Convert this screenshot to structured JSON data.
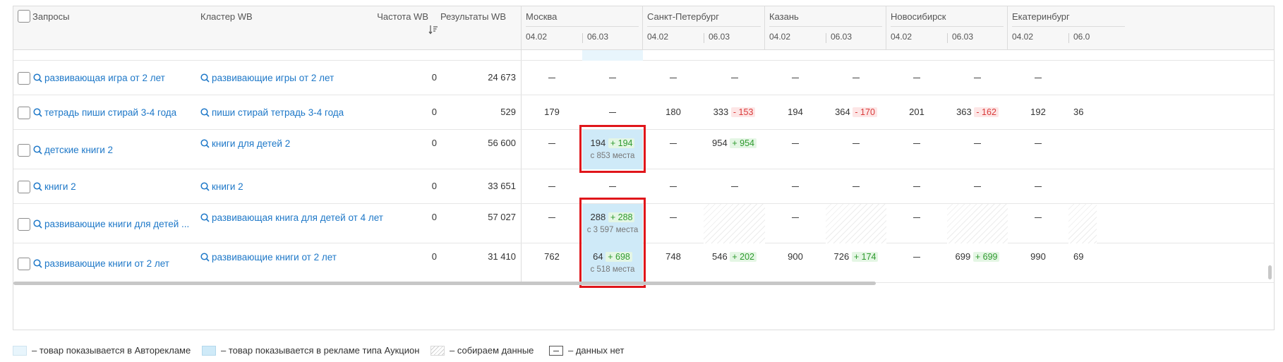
{
  "header": {
    "queries_label": "Запросы",
    "cluster_label": "Кластер WB",
    "freq_label": "Частота WB",
    "results_label": "Результаты WB",
    "cities": [
      {
        "name": "Москва",
        "d1": "04.02",
        "d2": "06.03"
      },
      {
        "name": "Санкт-Петербург",
        "d1": "04.02",
        "d2": "06.03"
      },
      {
        "name": "Казань",
        "d1": "04.02",
        "d2": "06.03"
      },
      {
        "name": "Новосибирск",
        "d1": "04.02",
        "d2": "06.03"
      },
      {
        "name": "Екатеринбург",
        "d1": "04.02",
        "d2": "06.0"
      }
    ]
  },
  "rows": [
    {
      "query": "развивающая игра от 2 лет",
      "cluster": "развивающие игры от 2 лет",
      "freq": "0",
      "results": "24 673",
      "msk1": "—",
      "msk2": "—",
      "spb1": "—",
      "spb2": "—",
      "kzn1": "—",
      "kzn2": "—",
      "nsk1": "—",
      "nsk2": "—",
      "ekb1": "—"
    },
    {
      "query": "тетрадь пиши стирай 3-4 года",
      "cluster": "пиши стирай тетрадь 3-4 года",
      "freq": "0",
      "results": "529",
      "msk1": "179",
      "msk2": "—",
      "spb1": "180",
      "spb2": "333",
      "spb2_delta": "- 153",
      "kzn1": "194",
      "kzn2": "364",
      "kzn2_delta": "- 170",
      "nsk1": "201",
      "nsk2": "363",
      "nsk2_delta": "- 162",
      "ekb1": "192",
      "ekb2": "36"
    },
    {
      "query": "детские книги 2",
      "cluster": "книги для детей 2",
      "freq": "0",
      "results": "56 600",
      "msk1": "—",
      "msk2": "194",
      "msk2_delta": "+ 194",
      "msk2_sub": "с 853 места",
      "spb1": "—",
      "spb2": "954",
      "spb2_delta": "+ 954",
      "kzn1": "—",
      "kzn2": "—",
      "nsk1": "—",
      "nsk2": "—",
      "ekb1": "—"
    },
    {
      "query": "книги 2",
      "cluster": "книги 2",
      "freq": "0",
      "results": "33 651",
      "msk1": "—",
      "msk2": "—",
      "spb1": "—",
      "spb2": "—",
      "kzn1": "—",
      "kzn2": "—",
      "nsk1": "—",
      "nsk2": "—",
      "ekb1": "—"
    },
    {
      "query": "развивающие книги для детей ...",
      "cluster": "развивающая книга для детей от 4 лет",
      "freq": "0",
      "results": "57 027",
      "msk1": "—",
      "msk2": "288",
      "msk2_delta": "+ 288",
      "msk2_sub": "с 3 597 места",
      "spb1": "—",
      "kzn1": "—",
      "nsk1": "—",
      "ekb1": "—"
    },
    {
      "query": "развивающие книги от 2 лет",
      "cluster": "развивающие книги от 2 лет",
      "freq": "0",
      "results": "31 410",
      "msk1": "762",
      "msk2": "64",
      "msk2_delta": "+ 698",
      "msk2_sub": "с 518 места",
      "spb1": "748",
      "spb2": "546",
      "spb2_delta": "+ 202",
      "kzn1": "900",
      "kzn2": "726",
      "kzn2_delta": "+ 174",
      "nsk1": "—",
      "nsk2": "699",
      "nsk2_delta": "+ 699",
      "ekb1": "990",
      "ekb2": "69"
    }
  ],
  "legend": {
    "auto": "– товар показывается в Авторекламе",
    "auction": "– товар показывается в рекламе типа Аукцион",
    "collecting": "– собираем данные",
    "nodata": "– данных нет"
  },
  "colors": {
    "link": "#1e78c8",
    "auction_bg": "#cfeaf8",
    "auto_bg": "#e8f5fc",
    "positive": "#2f9a2f",
    "negative": "#d93a3a",
    "highlight_box": "#e0161b"
  }
}
